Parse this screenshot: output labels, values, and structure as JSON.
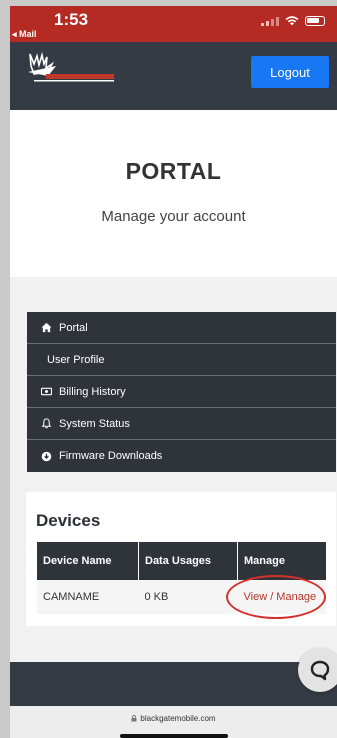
{
  "status_bar": {
    "time": "1:53",
    "back_app": "◂ Mail",
    "colors": {
      "background": "#b52a22"
    }
  },
  "header": {
    "logo_icon": "blackgate-logo",
    "logout_label": "Logout",
    "colors": {
      "background": "#353b44",
      "logout": "#1877f2"
    }
  },
  "hero": {
    "title": "PORTAL",
    "subtitle": "Manage your account"
  },
  "nav": {
    "items": [
      {
        "label": "Portal",
        "icon": "home-icon"
      },
      {
        "label": "User Profile",
        "icon": ""
      },
      {
        "label": "Billing History",
        "icon": "billing-icon"
      },
      {
        "label": "System Status",
        "icon": "bell-icon"
      },
      {
        "label": "Firmware Downloads",
        "icon": "download-icon"
      }
    ]
  },
  "devices": {
    "heading": "Devices",
    "columns": [
      "Device Name",
      "Data Usages",
      "Manage"
    ],
    "rows": [
      {
        "device_name": "CAMNAME",
        "data_usage": "0 KB",
        "manage": "View / Manage"
      }
    ],
    "highlight_color": "#d1322c"
  },
  "browser": {
    "url": "blackgatemobile.com",
    "lock_icon": "lock-icon"
  },
  "chat": {
    "icon": "chat-icon"
  }
}
